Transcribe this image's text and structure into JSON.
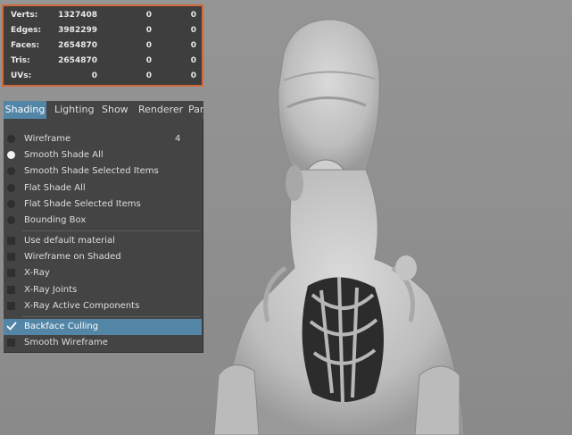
{
  "hud": {
    "rows": [
      {
        "label": "Verts:",
        "v1": "1327408",
        "v2": "0",
        "v3": "0"
      },
      {
        "label": "Edges:",
        "v1": "3982299",
        "v2": "0",
        "v3": "0"
      },
      {
        "label": "Faces:",
        "v1": "2654870",
        "v2": "0",
        "v3": "0"
      },
      {
        "label": "Tris:",
        "v1": "2654870",
        "v2": "0",
        "v3": "0"
      },
      {
        "label": "UVs:",
        "v1": "0",
        "v2": "0",
        "v3": "0"
      }
    ]
  },
  "menubar": {
    "tabs": [
      "Shading",
      "Lighting",
      "Show",
      "Renderer",
      "Panels"
    ],
    "active": "Shading"
  },
  "shading_menu": {
    "items": [
      {
        "label": "Wireframe",
        "hotkey": "4",
        "kind": "radio",
        "on": false
      },
      {
        "label": "Smooth Shade All",
        "hotkey": "",
        "kind": "radio",
        "on": true
      },
      {
        "label": "Smooth Shade Selected Items",
        "hotkey": "",
        "kind": "radio",
        "on": false
      },
      {
        "label": "Flat Shade All",
        "hotkey": "",
        "kind": "radio",
        "on": false
      },
      {
        "label": "Flat Shade Selected Items",
        "hotkey": "",
        "kind": "radio",
        "on": false
      },
      {
        "label": "Bounding Box",
        "hotkey": "",
        "kind": "radio",
        "on": false
      },
      {
        "label": "Use default material",
        "hotkey": "",
        "kind": "check",
        "on": false
      },
      {
        "label": "Wireframe on Shaded",
        "hotkey": "",
        "kind": "check",
        "on": false
      },
      {
        "label": "X-Ray",
        "hotkey": "",
        "kind": "check",
        "on": false
      },
      {
        "label": "X-Ray Joints",
        "hotkey": "",
        "kind": "check",
        "on": false
      },
      {
        "label": "X-Ray Active Components",
        "hotkey": "",
        "kind": "check",
        "on": false
      },
      {
        "label": "Backface Culling",
        "hotkey": "",
        "kind": "check",
        "on": true
      },
      {
        "label": "Smooth Wireframe",
        "hotkey": "",
        "kind": "check",
        "on": false
      }
    ],
    "highlighted": "Backface Culling"
  },
  "colors": {
    "hud_border": "#d2693a",
    "accent": "#5285a6",
    "panel_bg": "#444444",
    "viewport_bg": "#8f8f8f"
  },
  "icons": {
    "radio": "radio-button-icon",
    "check": "checkbox-icon",
    "checkmark": "checkmark-icon"
  }
}
